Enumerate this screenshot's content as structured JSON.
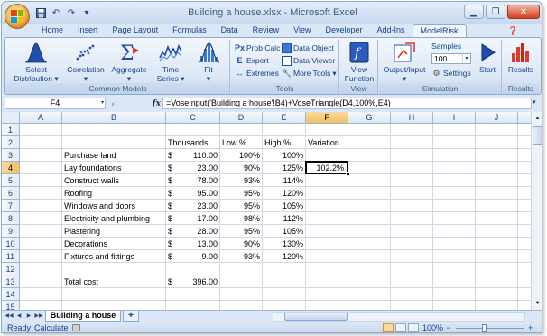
{
  "window": {
    "title": "Building a house.xlsx - Microsoft Excel"
  },
  "qat": [
    "save-icon",
    "undo-icon",
    "redo-icon",
    "customize-icon"
  ],
  "tabs": [
    "Home",
    "Insert",
    "Page Layout",
    "Formulas",
    "Data",
    "Review",
    "View",
    "Developer",
    "Add-Ins",
    "ModelRisk"
  ],
  "active_tab": "ModelRisk",
  "ribbon": {
    "common_models": {
      "label": "Common Models",
      "select_distribution": "Select Distribution",
      "select_distribution_arrow": "▾",
      "correlation": "Correlation",
      "correlation_arrow": "▾",
      "aggregate": "Aggregate",
      "aggregate_arrow": "▾",
      "time_series": "Time Series",
      "time_series_arrow": "▾",
      "fit": "Fit",
      "fit_arrow": "▾"
    },
    "tools": {
      "label": "Tools",
      "prob_calc": "Prob Calc",
      "prob_calc_arrow": "▾",
      "expert": "Expert",
      "extremes": "Extremes",
      "data_object": "Data Object",
      "data_viewer": "Data Viewer",
      "more_tools": "More Tools",
      "more_tools_arrow": "▾"
    },
    "view": {
      "label": "View",
      "view_function": "View Function"
    },
    "simulation": {
      "label": "Simulation",
      "output_input": "Output/Input",
      "output_input_arrow": "▾",
      "samples_label": "Samples",
      "samples_value": "100",
      "settings": "Settings",
      "start": "Start"
    },
    "results": {
      "label": "Results",
      "results": "Results"
    }
  },
  "formula_bar": {
    "name_box": "F4",
    "fx": "fx",
    "formula": "=VoseInput('Building a house'!B4)+VoseTriangle(D4,100%,E4)"
  },
  "columns": [
    "A",
    "B",
    "C",
    "D",
    "E",
    "F",
    "G",
    "H",
    "I",
    "J",
    "K"
  ],
  "rows": [
    "1",
    "2",
    "3",
    "4",
    "5",
    "6",
    "7",
    "8",
    "9",
    "10",
    "11",
    "12",
    "13",
    "14",
    "15"
  ],
  "sheet": {
    "headers": {
      "thousands": "Thousands",
      "low": "Low %",
      "high": "High %",
      "variation": "Variation"
    },
    "items": [
      {
        "name": "Purchase land",
        "cur": "$",
        "amount": "110.00",
        "low": "100%",
        "high": "100%",
        "variation": ""
      },
      {
        "name": "Lay foundations",
        "cur": "$",
        "amount": "23.00",
        "low": "90%",
        "high": "125%",
        "variation": "102.2%"
      },
      {
        "name": "Construct walls",
        "cur": "$",
        "amount": "78.00",
        "low": "93%",
        "high": "114%",
        "variation": ""
      },
      {
        "name": "Roofing",
        "cur": "$",
        "amount": "95.00",
        "low": "95%",
        "high": "120%",
        "variation": ""
      },
      {
        "name": "Windows and doors",
        "cur": "$",
        "amount": "23.00",
        "low": "95%",
        "high": "105%",
        "variation": ""
      },
      {
        "name": "Electricity and plumbing",
        "cur": "$",
        "amount": "17.00",
        "low": "98%",
        "high": "112%",
        "variation": ""
      },
      {
        "name": "Plastering",
        "cur": "$",
        "amount": "28.00",
        "low": "95%",
        "high": "105%",
        "variation": ""
      },
      {
        "name": "Decorations",
        "cur": "$",
        "amount": "13.00",
        "low": "90%",
        "high": "130%",
        "variation": ""
      },
      {
        "name": "Fixtures and fittings",
        "cur": "$",
        "amount": "9.00",
        "low": "93%",
        "high": "120%",
        "variation": ""
      }
    ],
    "total": {
      "label": "Total cost",
      "cur": "$",
      "amount": "396.00"
    }
  },
  "sheet_tabs": {
    "active": "Building a house",
    "nav": [
      "◀◀",
      "◀",
      "▶",
      "▶▶"
    ]
  },
  "status": {
    "ready": "Ready",
    "calculate": "Calculate",
    "zoom": "100%",
    "zoom_minus": "−",
    "zoom_plus": "+",
    "zoom_fraction": 0.42
  },
  "colors": {
    "accent": "#15428b",
    "ribbon_bg": "#dbe7f6",
    "selection": "#f9d99f",
    "close": "#d3401d"
  }
}
